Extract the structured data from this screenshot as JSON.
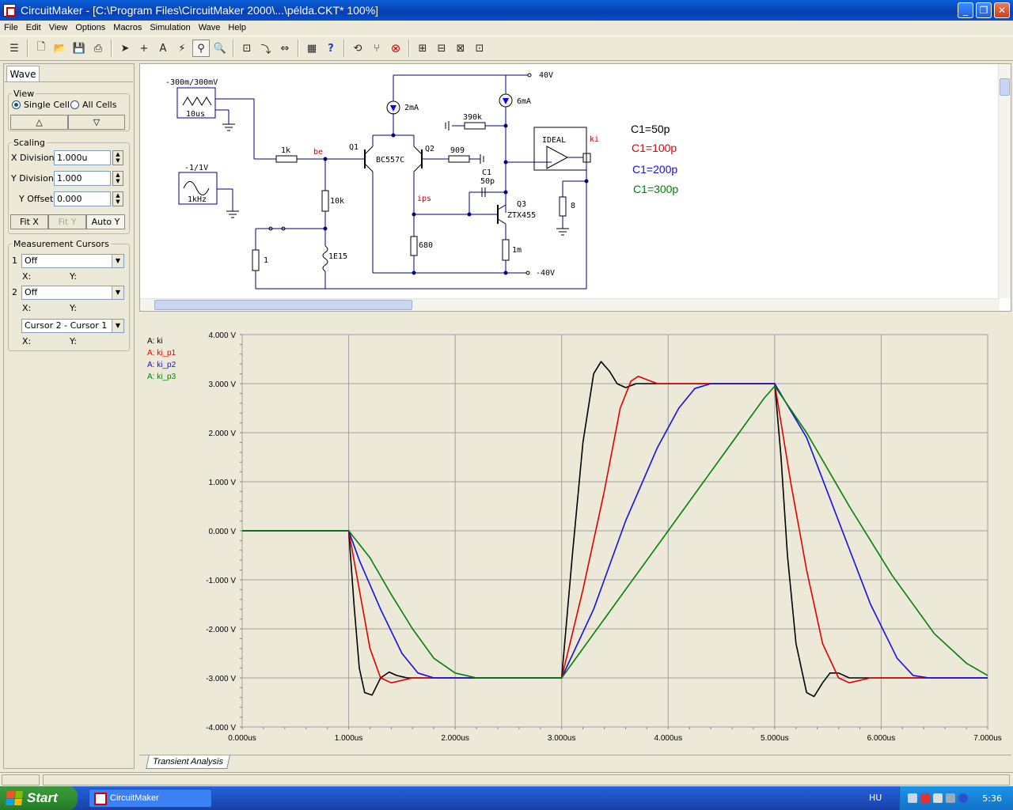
{
  "window": {
    "title": "CircuitMaker - [C:\\Program Files\\CircuitMaker 2000\\...\\példa.CKT* 100%]",
    "buttons": {
      "minimize": "_",
      "restore": "❐",
      "close": "✕"
    }
  },
  "menu": [
    "File",
    "Edit",
    "View",
    "Options",
    "Macros",
    "Simulation",
    "Wave",
    "Help"
  ],
  "panel": {
    "tab": "Wave",
    "view_legend": "View",
    "single_cell": "Single Cell",
    "all_cells": "All Cells",
    "scaling_legend": "Scaling",
    "x_division_label": "X Division",
    "x_division_value": "1.000u",
    "y_division_label": "Y Division",
    "y_division_value": "1.000",
    "y_offset_label": "Y Offset",
    "y_offset_value": "0.000",
    "fit_x": "Fit X",
    "fit_y": "Fit Y",
    "auto_y": "Auto Y",
    "cursors_legend": "Measurement Cursors",
    "cursor1_num": "1",
    "cursor1_value": "Off",
    "cursor2_num": "2",
    "cursor2_value": "Off",
    "diff_value": "Cursor 2 - Cursor 1",
    "x_label": "X:",
    "y_label": "Y:"
  },
  "schematic": {
    "labels": {
      "sq_src": "-300m/300mV",
      "sq_freq": "10us",
      "sin_src": "-1/1V",
      "sin_freq": "1kHz",
      "r1k": "1k",
      "be": "be",
      "q1": "Q1",
      "bc557": "BC557C",
      "q2": "Q2",
      "r909": "909",
      "r390k": "390k",
      "i2ma": "2mA",
      "i6ma": "6mA",
      "v40": "40V",
      "vm40": "-40V",
      "ideal": "IDEAL",
      "ki": "ki",
      "c1": "C1",
      "c1v": "50p",
      "q3": "Q3",
      "ztx": "ZTX455",
      "ips": "ips",
      "r10k": "10k",
      "r680": "680",
      "r1m": "1m",
      "r8": "8",
      "r1": "1",
      "r1e15": "1E15"
    },
    "notes": [
      {
        "text": "C1=50p",
        "color": "#000000"
      },
      {
        "text": "C1=100p",
        "color": "#E00000"
      },
      {
        "text": "C1=200p",
        "color": "#1010E0"
      },
      {
        "text": "C1=300p",
        "color": "#008000"
      }
    ]
  },
  "bottom_tab": "Transient Analysis",
  "taskbar": {
    "start": "Start",
    "item": "CircuitMaker",
    "lang": "HU",
    "clock": "5:36"
  },
  "chart_data": {
    "type": "line",
    "xlabel": "",
    "ylabel": "",
    "xlim": [
      0,
      7
    ],
    "ylim": [
      -4,
      4
    ],
    "x_ticks": [
      "0.000us",
      "1.000us",
      "2.000us",
      "3.000us",
      "4.000us",
      "5.000us",
      "6.000us",
      "7.000us"
    ],
    "y_ticks": [
      "4.000 V",
      "3.000 V",
      "2.000 V",
      "1.000 V",
      "0.000 V",
      "-1.000 V",
      "-2.000 V",
      "-3.000 V",
      "-4.000 V"
    ],
    "grid": true,
    "legend_position": "top-left",
    "series": [
      {
        "name": "A: ki",
        "color": "#000000",
        "points": [
          [
            0,
            0
          ],
          [
            1,
            0
          ],
          [
            1.05,
            -1.5
          ],
          [
            1.1,
            -2.8
          ],
          [
            1.15,
            -3.3
          ],
          [
            1.22,
            -3.35
          ],
          [
            1.3,
            -3.0
          ],
          [
            1.38,
            -2.88
          ],
          [
            1.45,
            -2.95
          ],
          [
            1.55,
            -3.0
          ],
          [
            3,
            -3.0
          ],
          [
            3.1,
            -0.5
          ],
          [
            3.2,
            1.8
          ],
          [
            3.3,
            3.2
          ],
          [
            3.37,
            3.45
          ],
          [
            3.45,
            3.25
          ],
          [
            3.52,
            3.0
          ],
          [
            3.6,
            2.92
          ],
          [
            3.7,
            3.0
          ],
          [
            5,
            3.0
          ],
          [
            5.06,
            1.5
          ],
          [
            5.12,
            -0.5
          ],
          [
            5.2,
            -2.3
          ],
          [
            5.3,
            -3.3
          ],
          [
            5.37,
            -3.38
          ],
          [
            5.45,
            -3.1
          ],
          [
            5.52,
            -2.9
          ],
          [
            5.6,
            -2.9
          ],
          [
            5.7,
            -3.0
          ],
          [
            7,
            -3.0
          ]
        ]
      },
      {
        "name": "A: ki_p1",
        "color": "#E00000",
        "points": [
          [
            0,
            0
          ],
          [
            1,
            0
          ],
          [
            1.1,
            -1.2
          ],
          [
            1.2,
            -2.4
          ],
          [
            1.3,
            -3.0
          ],
          [
            1.4,
            -3.1
          ],
          [
            1.5,
            -3.05
          ],
          [
            1.6,
            -3.0
          ],
          [
            3,
            -3.0
          ],
          [
            3.2,
            -1.2
          ],
          [
            3.4,
            0.8
          ],
          [
            3.55,
            2.5
          ],
          [
            3.65,
            3.05
          ],
          [
            3.72,
            3.15
          ],
          [
            3.8,
            3.08
          ],
          [
            3.9,
            3.0
          ],
          [
            5,
            3.0
          ],
          [
            5.15,
            1.0
          ],
          [
            5.3,
            -0.8
          ],
          [
            5.45,
            -2.3
          ],
          [
            5.6,
            -3.0
          ],
          [
            5.7,
            -3.1
          ],
          [
            5.8,
            -3.05
          ],
          [
            5.9,
            -3.0
          ],
          [
            7,
            -3.0
          ]
        ]
      },
      {
        "name": "A: ki_p2",
        "color": "#1010E0",
        "points": [
          [
            0,
            0
          ],
          [
            1,
            0
          ],
          [
            1.1,
            -0.6
          ],
          [
            1.3,
            -1.6
          ],
          [
            1.5,
            -2.5
          ],
          [
            1.65,
            -2.9
          ],
          [
            1.8,
            -3.0
          ],
          [
            3,
            -3.0
          ],
          [
            3.3,
            -1.6
          ],
          [
            3.6,
            0.2
          ],
          [
            3.9,
            1.7
          ],
          [
            4.1,
            2.5
          ],
          [
            4.25,
            2.9
          ],
          [
            4.4,
            3.0
          ],
          [
            5,
            3.0
          ],
          [
            5.3,
            1.9
          ],
          [
            5.6,
            0.2
          ],
          [
            5.9,
            -1.5
          ],
          [
            6.15,
            -2.6
          ],
          [
            6.3,
            -2.95
          ],
          [
            6.45,
            -3.0
          ],
          [
            7,
            -3.0
          ]
        ]
      },
      {
        "name": "A: ki_p3",
        "color": "#008000",
        "points": [
          [
            0,
            0
          ],
          [
            1,
            0
          ],
          [
            1.2,
            -0.55
          ],
          [
            1.4,
            -1.3
          ],
          [
            1.6,
            -2.0
          ],
          [
            1.8,
            -2.6
          ],
          [
            2.0,
            -2.9
          ],
          [
            2.2,
            -3.0
          ],
          [
            3,
            -3.0
          ],
          [
            3.4,
            -1.8
          ],
          [
            3.8,
            -0.6
          ],
          [
            4.2,
            0.6
          ],
          [
            4.6,
            1.8
          ],
          [
            4.9,
            2.7
          ],
          [
            5,
            2.95
          ],
          [
            5.3,
            2.0
          ],
          [
            5.7,
            0.5
          ],
          [
            6.1,
            -0.9
          ],
          [
            6.5,
            -2.1
          ],
          [
            6.8,
            -2.7
          ],
          [
            7,
            -2.95
          ]
        ]
      }
    ]
  }
}
